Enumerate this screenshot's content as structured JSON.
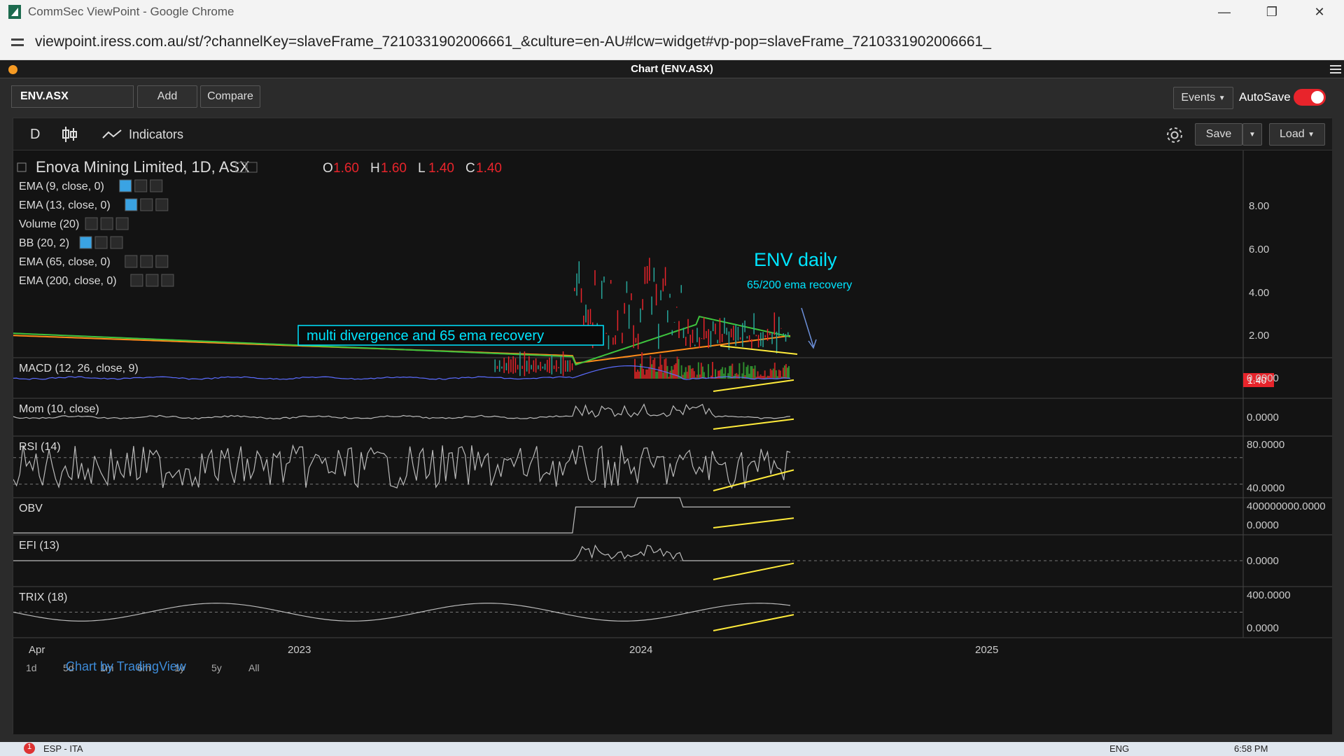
{
  "browser": {
    "title": "CommSec ViewPoint - Google Chrome",
    "url": "viewpoint.iress.com.au/st/?channelKey=slaveFrame_7210331902006661_&culture=en-AU#lcw=widget#vp-pop=slaveFrame_7210331902006661_"
  },
  "app": {
    "title": "Chart (ENV.ASX)",
    "symbol": "ENV.ASX",
    "add": "Add",
    "compare": "Compare",
    "events": "Events",
    "autosave": "AutoSave"
  },
  "toolbar": {
    "interval": "D",
    "indicators": "Indicators",
    "save": "Save",
    "load": "Load"
  },
  "chart": {
    "title": "Enova Mining Limited, 1D, ASX",
    "ohlc": {
      "o_label": "O",
      "o": "1.60",
      "h_label": "H",
      "h": "1.60",
      "l_label": "L",
      "l": "1.40",
      "c_label": "C",
      "c": "1.40"
    },
    "studies": [
      "EMA (9, close, 0)",
      "EMA (13, close, 0)",
      "Volume (20)",
      "BB (20, 2)",
      "EMA (65, close, 0)",
      "EMA (200, close, 0)"
    ],
    "annotation_box": "multi divergence and 65 ema recovery",
    "annotation_title": "ENV daily",
    "annotation_sub": "65/200 ema recovery",
    "last_price": "1.40",
    "price_ticks": [
      "8.00",
      "6.00",
      "4.00",
      "2.00",
      "0.00"
    ],
    "panes": [
      {
        "name": "MACD (12, 26, close, 9)",
        "ticks": [
          "0.0000"
        ]
      },
      {
        "name": "Mom (10, close)",
        "ticks": [
          "0.0000"
        ]
      },
      {
        "name": "RSI (14)",
        "ticks": [
          "80.0000",
          "40.0000"
        ]
      },
      {
        "name": "OBV",
        "ticks": [
          "400000000.0000",
          "0.0000"
        ]
      },
      {
        "name": "EFI (13)",
        "ticks": [
          "0.0000"
        ]
      },
      {
        "name": "TRIX (18)",
        "ticks": [
          "400.0000",
          "0.0000"
        ]
      }
    ],
    "x_ticks": [
      "Apr",
      "2023",
      "2024",
      "2025"
    ],
    "ranges": [
      "1d",
      "5d",
      "1m",
      "6m",
      "1y",
      "5y",
      "All"
    ],
    "watermark": "Chart by TradingView"
  },
  "taskbar": {
    "lang": "ESP - ITA",
    "kb": "ENG",
    "time": "6:58 PM",
    "badge": "1"
  },
  "colors": {
    "accent": "#00e5ff",
    "ema_green": "#3ec43e",
    "ema_orange": "#ff8c1a",
    "trend": "#ffeb3b",
    "down": "#e8242b",
    "up": "#26a69a"
  }
}
